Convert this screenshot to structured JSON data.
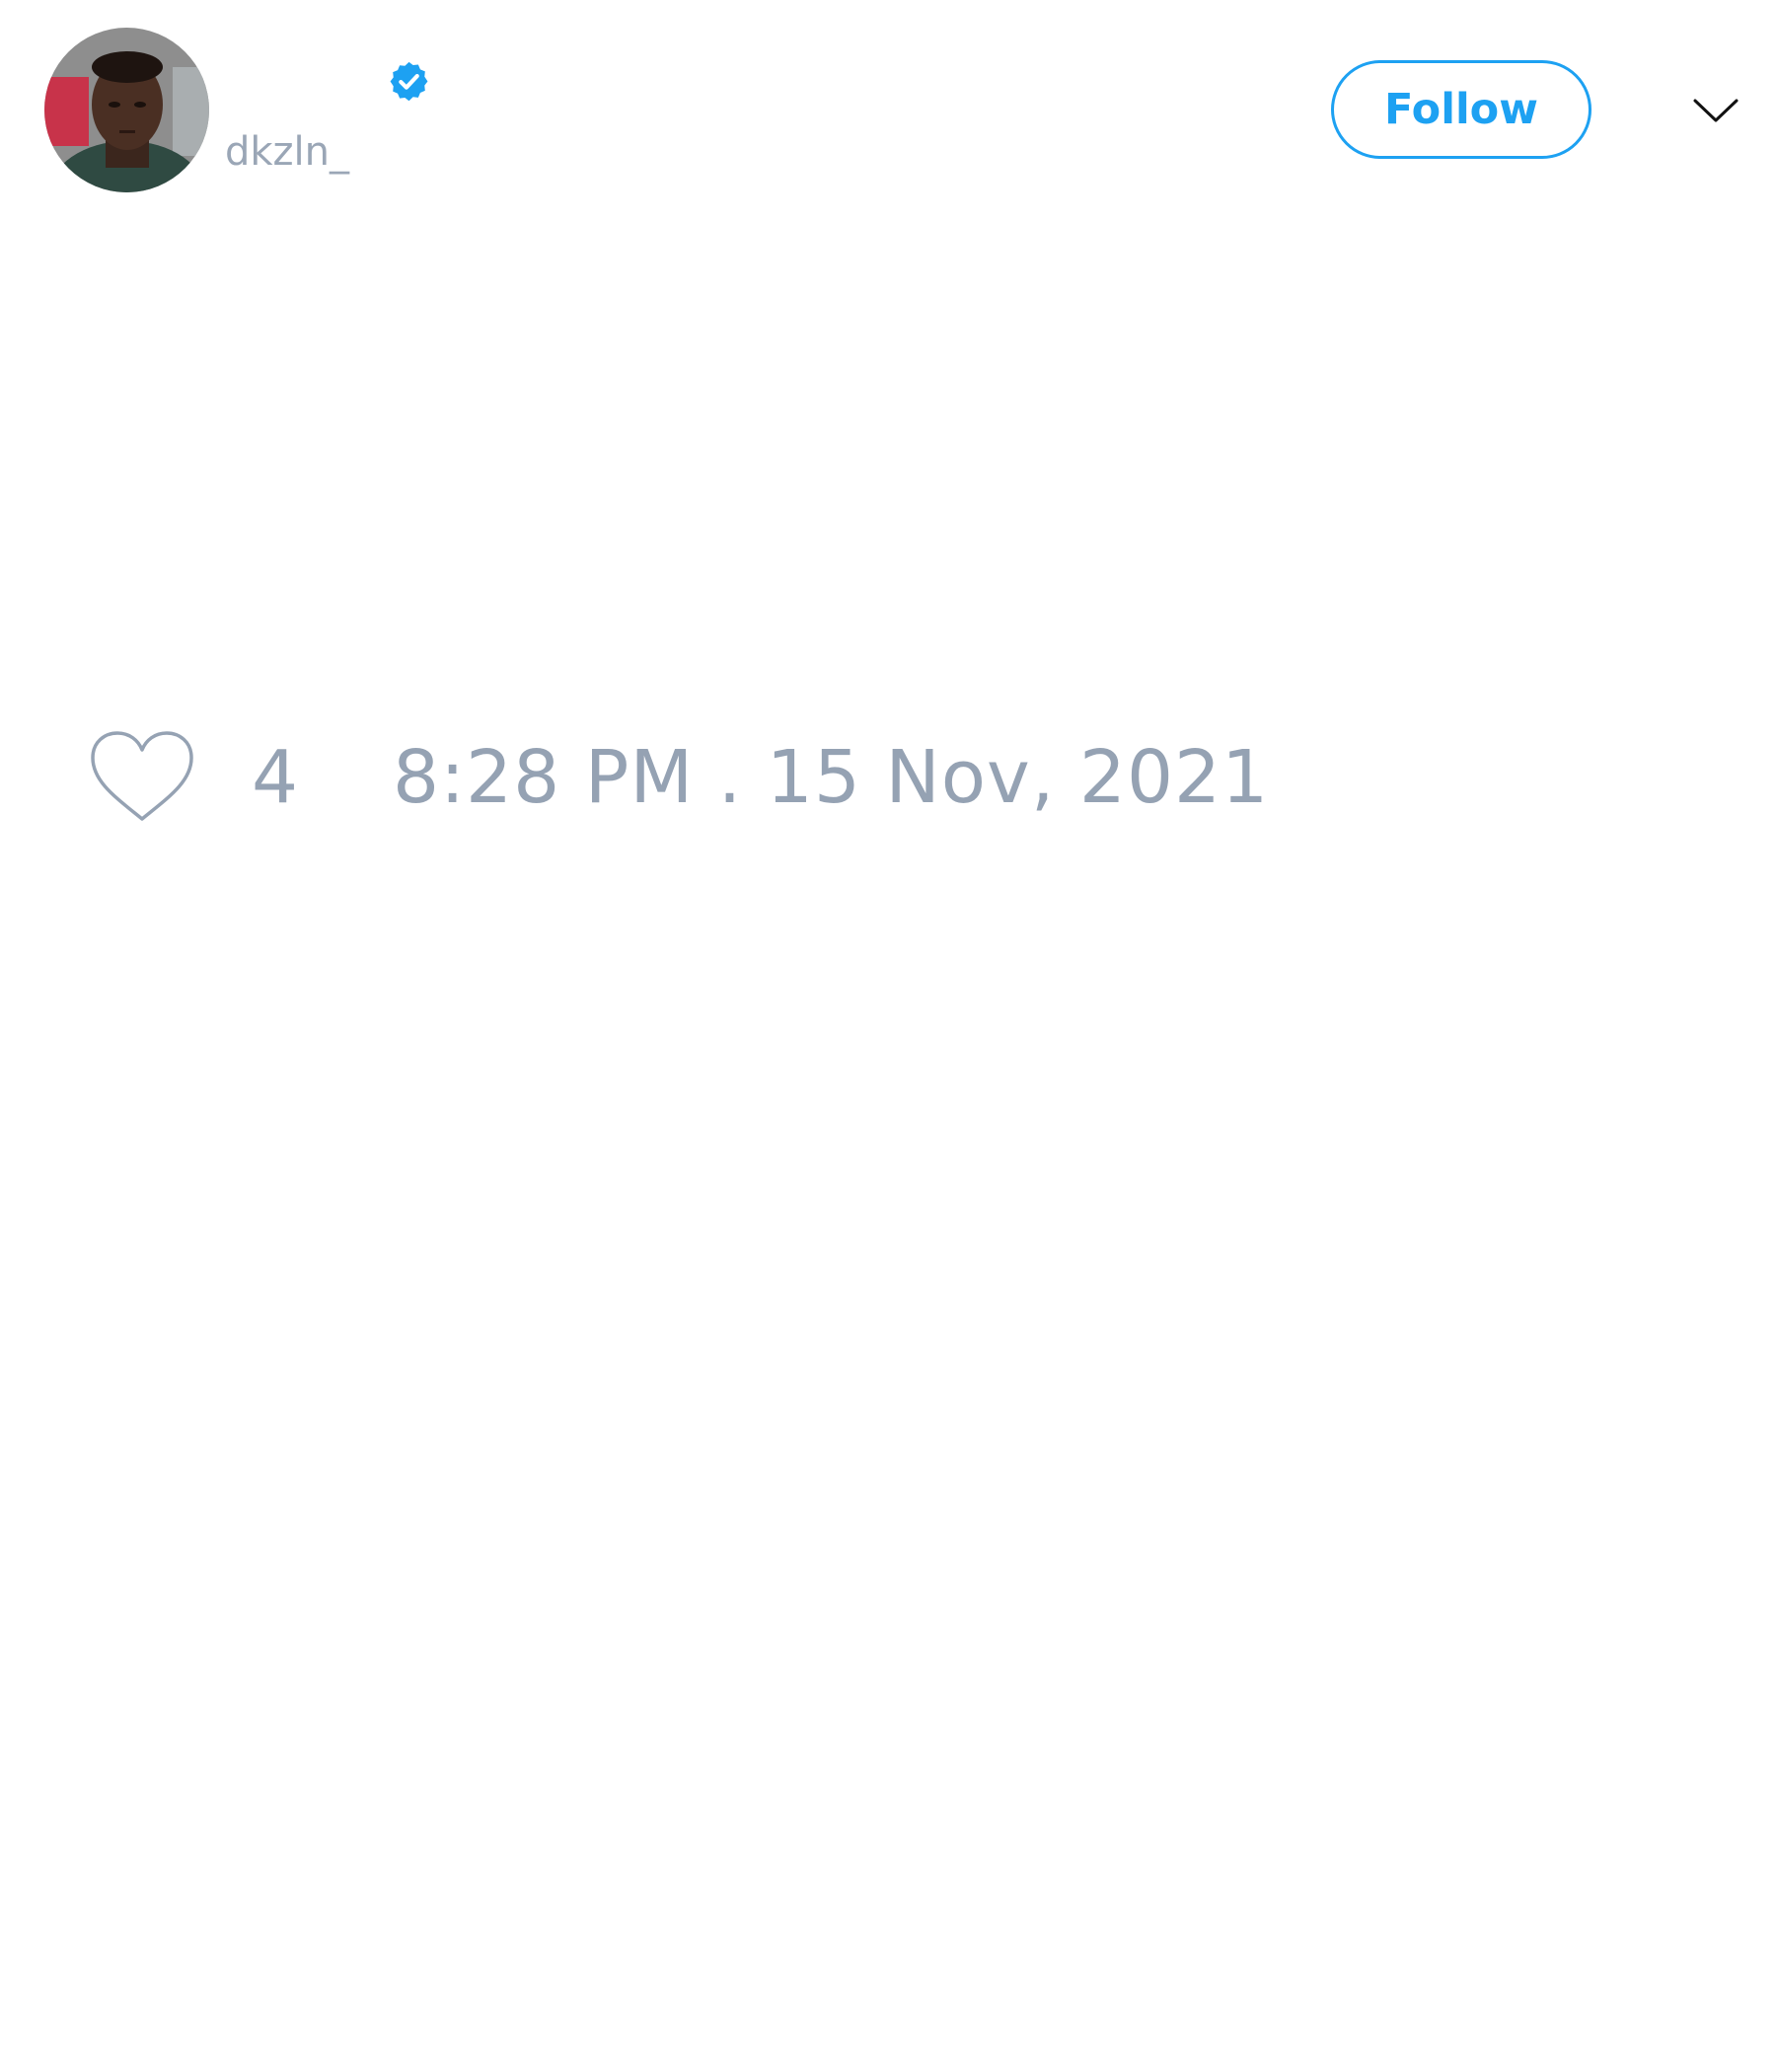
{
  "tweet": {
    "author": {
      "handle": "dkzln_",
      "verified": true
    },
    "follow_label": "Follow",
    "likes": "4",
    "timestamp": "8:28 PM . 15 Nov, 2021"
  },
  "colors": {
    "accent": "#1da1f2",
    "muted_text": "#95a2b3"
  },
  "icons": {
    "verified": "verified-badge-icon",
    "menu": "chevron-down-icon",
    "like": "heart-icon"
  }
}
